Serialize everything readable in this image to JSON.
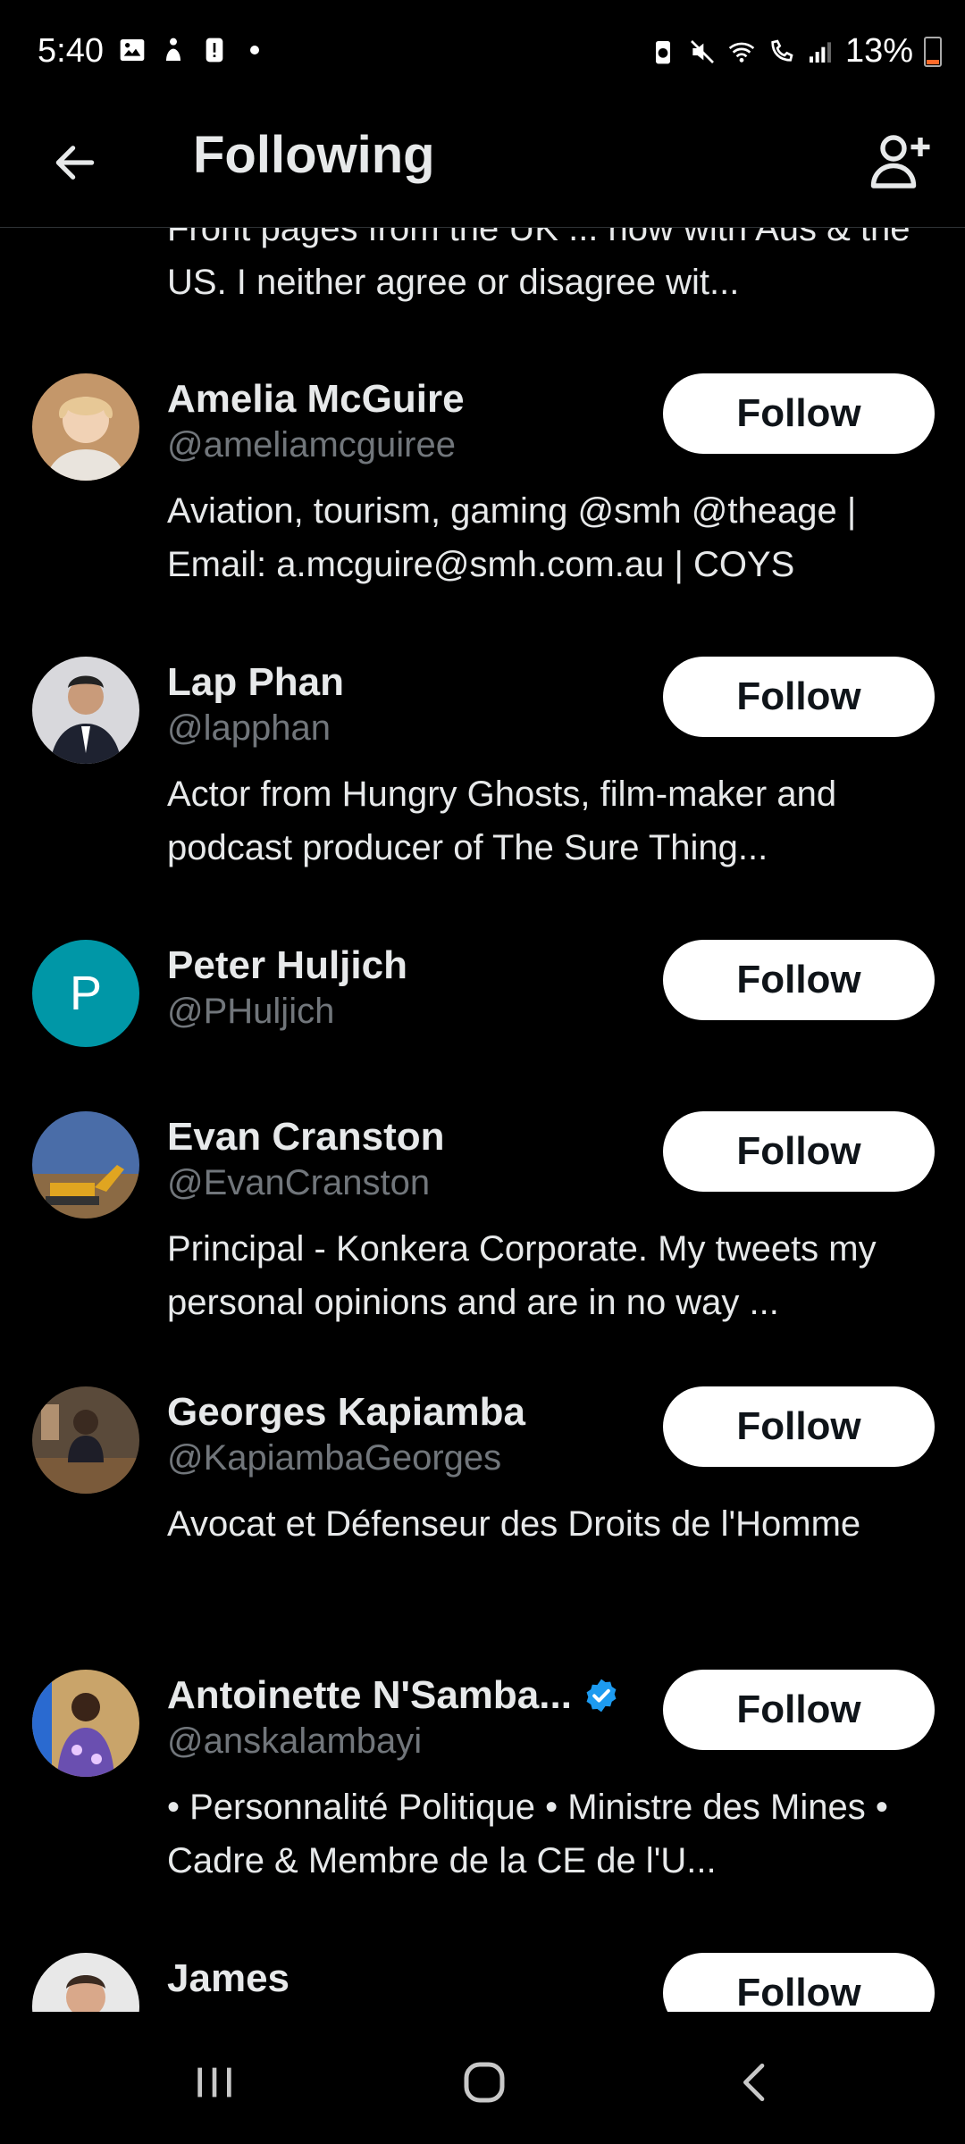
{
  "status": {
    "time": "5:40",
    "battery": "13%",
    "left_icons": [
      "gallery-icon",
      "accessibility-icon",
      "alert-icon",
      "dot-icon"
    ],
    "right_icons": [
      "battery-saver-icon",
      "mute-icon",
      "wifi-icon",
      "wifi-call-icon",
      "signal-icon"
    ]
  },
  "header": {
    "title": "Following",
    "back_icon": "arrow-left-icon",
    "add_icon": "add-user-icon"
  },
  "partial_bio": "Front pages from the UK ... now with Aus & the US.  I neither agree or disagree wit...",
  "users": [
    {
      "name": "Amelia McGuire",
      "handle": "@ameliamcguiree",
      "bio": "Aviation, tourism, gaming @smh @theage | Email: a.mcguire@smh.com.au | COYS",
      "follow_label": "Follow",
      "verified": false,
      "avatar_color": "#c4976a"
    },
    {
      "name": "Lap Phan",
      "handle": "@lapphan",
      "bio": "Actor from Hungry Ghosts, film-maker and podcast producer of The Sure Thing...",
      "follow_label": "Follow",
      "verified": false,
      "avatar_color": "#d8d8dc"
    },
    {
      "name": "Peter Huljich",
      "handle": "@PHuljich",
      "bio": "",
      "follow_label": "Follow",
      "verified": false,
      "avatar_letter": "P",
      "avatar_color": "#0097a7"
    },
    {
      "name": "Evan Cranston",
      "handle": "@EvanCranston",
      "bio": "Principal - Konkera Corporate. My tweets my personal opinions and are in no way ...",
      "follow_label": "Follow",
      "verified": false,
      "avatar_color": "#4a6da8"
    },
    {
      "name": "Georges Kapiamba",
      "handle": "@KapiambaGeorges",
      "bio": "Avocat et Défenseur des Droits de l'Homme",
      "follow_label": "Follow",
      "verified": false,
      "avatar_color": "#5a4a3a"
    },
    {
      "name": "Antoinette N'Samba...",
      "handle": "@anskalambayi",
      "bio": "• Personnalité Politique • Ministre des Mines • Cadre & Membre de la CE de l'U...",
      "follow_label": "Follow",
      "verified": true,
      "avatar_color": "#6a4fb0"
    },
    {
      "name": "James",
      "handle": "",
      "bio": "",
      "follow_label": "Follow",
      "verified": false,
      "avatar_color": "#e8e8e8"
    }
  ],
  "colors": {
    "background": "#000000",
    "text": "#e7e9ea",
    "secondary": "#71767b",
    "verified": "#1d9bf0",
    "follow_bg": "#ffffff"
  },
  "navbar": {
    "recents_icon": "recents-icon",
    "home_icon": "home-icon",
    "back_icon": "back-chevron-icon"
  }
}
